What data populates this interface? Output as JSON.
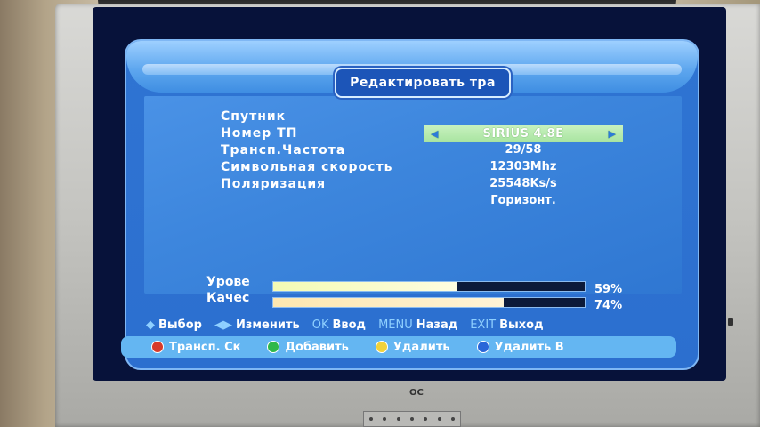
{
  "title": "Редактировать тра",
  "fields": {
    "labels": [
      "Спутник",
      "Номер ТП",
      "Трансп.Частота",
      "Символьная скорость",
      "Поляризация"
    ],
    "satellite": "SIRIUS 4.8E",
    "tp_number": "29/58",
    "frequency": "12303Mhz",
    "symbol_rate": "25548Ks/s",
    "polarization": "Горизонт."
  },
  "signal": {
    "level_label": "Урове",
    "quality_label": "Качес",
    "level_pct": 59,
    "quality_pct": 74,
    "level_text": "59%",
    "quality_text": "74%"
  },
  "help": {
    "select": "Выбор",
    "change": "Изменить",
    "ok_key": "OK",
    "ok_label": "Ввод",
    "menu_key": "MENU",
    "menu_label": "Назад",
    "exit_key": "EXIT",
    "exit_label": "Выход"
  },
  "color_keys": {
    "red": "Трансп. Ск",
    "green": "Добавить",
    "yellow": "Удалить",
    "blue": "Удалить В"
  },
  "brand": "OC",
  "colors": {
    "red": "#d83a2a",
    "green": "#2fb84a",
    "yellow": "#f0d23a",
    "blue": "#2a66d8"
  }
}
